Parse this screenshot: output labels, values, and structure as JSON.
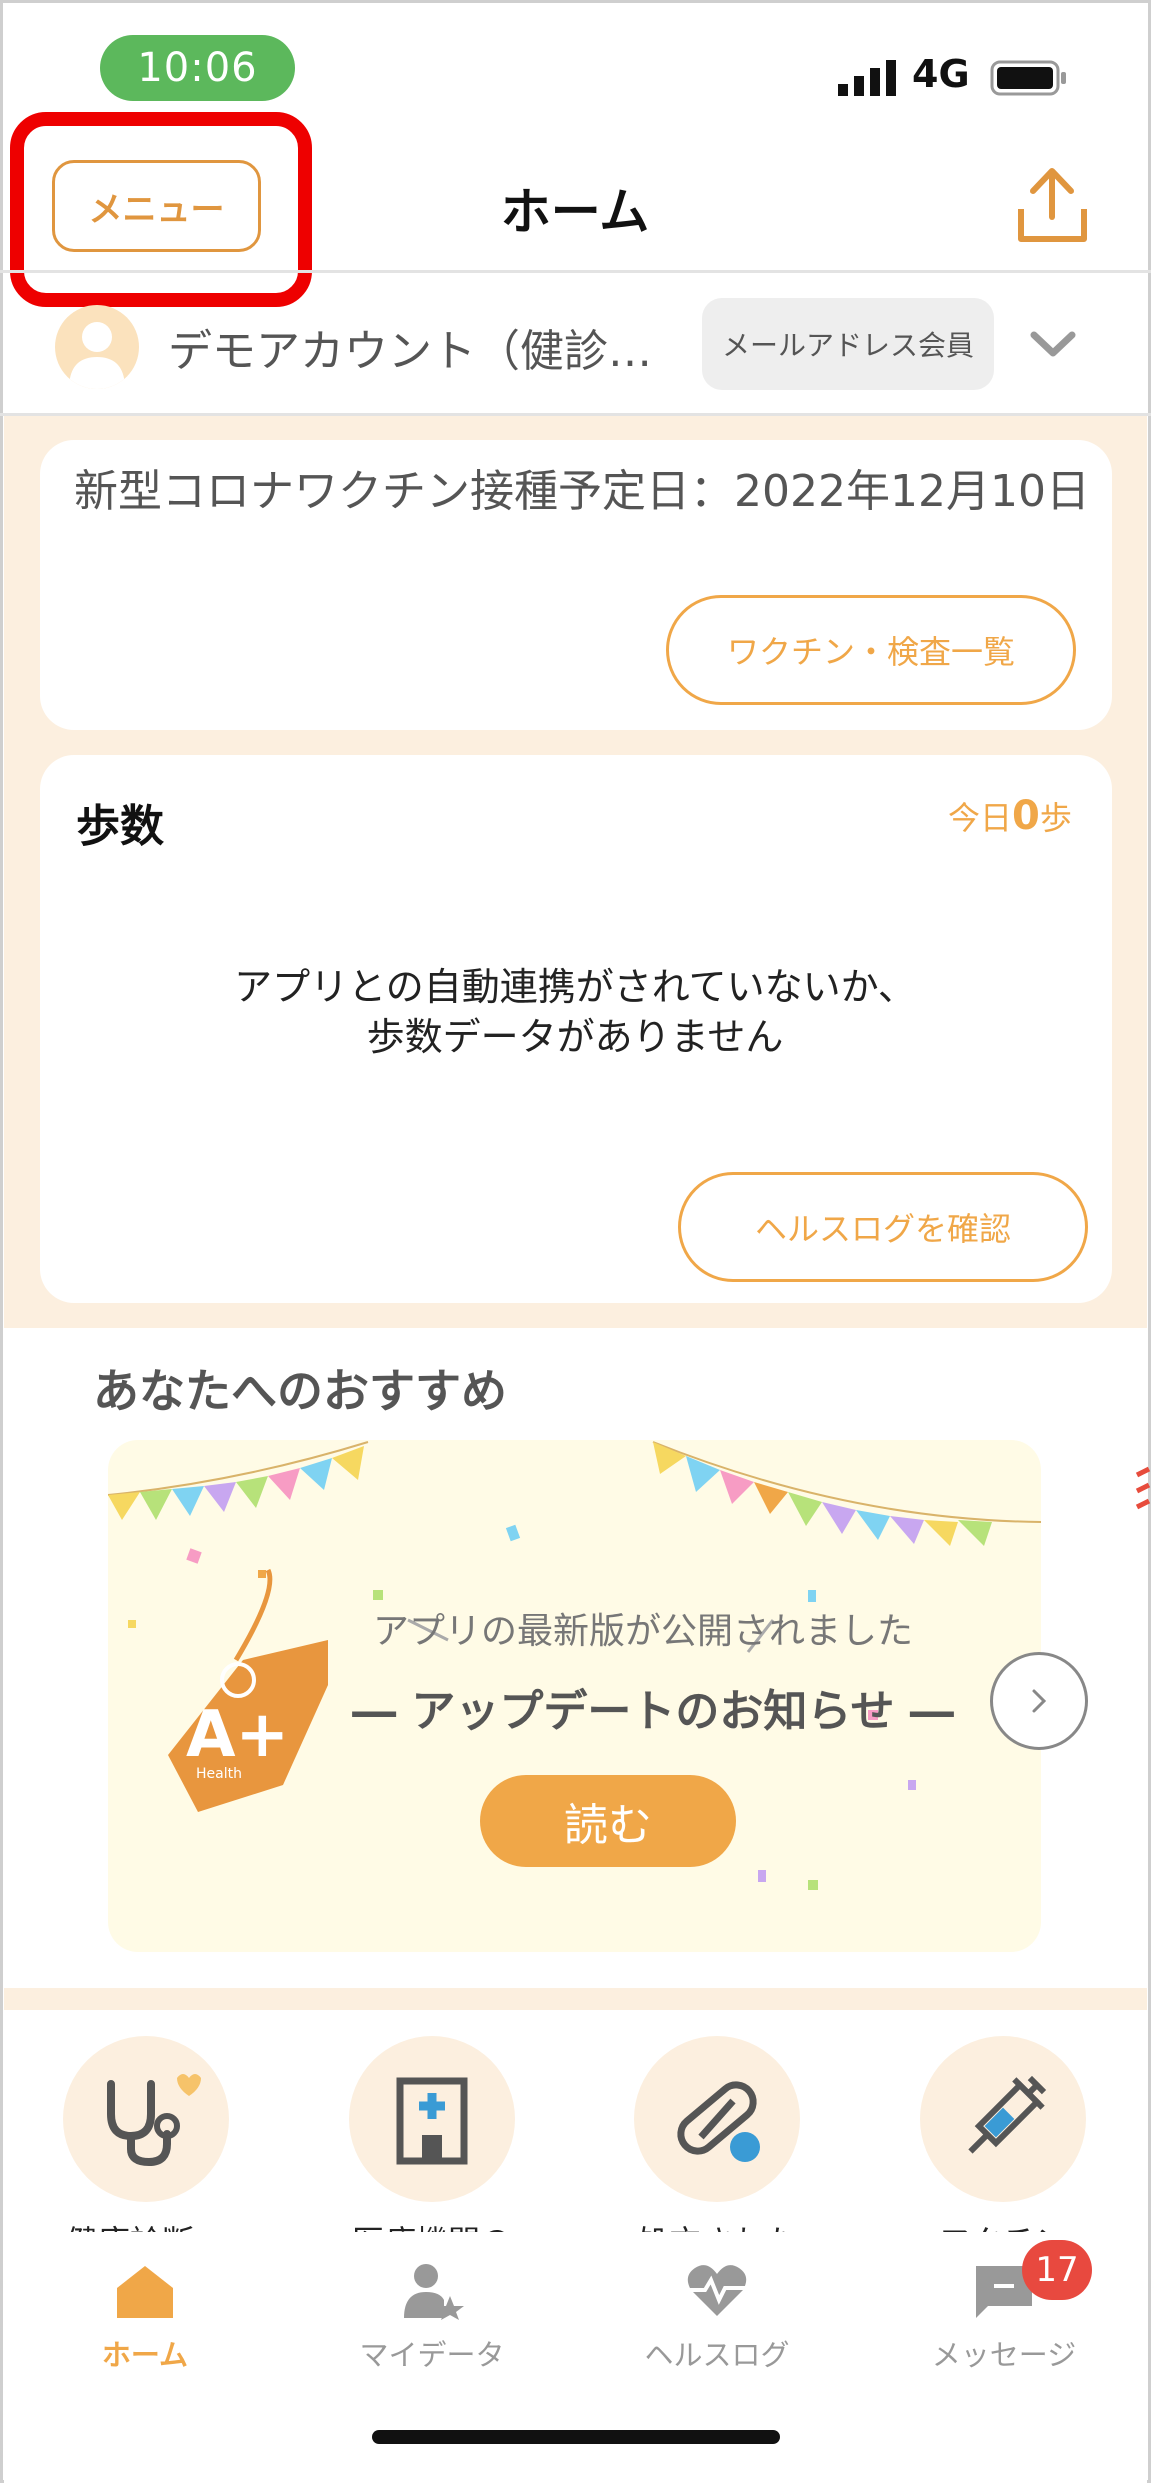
{
  "status_bar": {
    "time": "10:06",
    "network": "4G"
  },
  "header": {
    "menu_label": "メニュー",
    "title": "ホーム"
  },
  "account": {
    "name": "デモアカウント（健診…",
    "member_type": "メールアドレス会員"
  },
  "vaccine_card": {
    "text": "新型コロナワクチン接種予定日：2022年12月10日",
    "button_label": "ワクチン・検査一覧"
  },
  "steps_card": {
    "title": "歩数",
    "today_prefix": "今日",
    "today_value": "0",
    "today_unit": "歩",
    "message_line1": "アプリとの自動連携がされていないか、",
    "message_line2": "歩数データがありません",
    "button_label": "ヘルスログを確認"
  },
  "recommend": {
    "title": "あなたへのおすすめ",
    "banner_sub": "アプリの最新版が公開されました",
    "banner_main": "― アップデートのお知らせ ―",
    "banner_button": "読む",
    "tag_text": "A+",
    "tag_sub": "Health"
  },
  "shortcuts": [
    {
      "label": "健康診断・",
      "icon": "stethoscope-icon"
    },
    {
      "label": "医療機関の",
      "icon": "hospital-icon"
    },
    {
      "label": "処方された",
      "icon": "pill-icon"
    },
    {
      "label": "ワクチン",
      "icon": "syringe-icon"
    }
  ],
  "tabs": [
    {
      "label": "ホーム",
      "icon": "home-icon",
      "active": true
    },
    {
      "label": "マイデータ",
      "icon": "mydata-icon",
      "active": false
    },
    {
      "label": "ヘルスログ",
      "icon": "health-heart-icon",
      "active": false
    },
    {
      "label": "メッセージ",
      "icon": "message-icon",
      "active": false
    }
  ],
  "message_badge": "17",
  "colors": {
    "accent": "#f0a748",
    "highlight": "#ee0000",
    "time_pill": "#5cb85c",
    "beige": "#fcefdf"
  }
}
